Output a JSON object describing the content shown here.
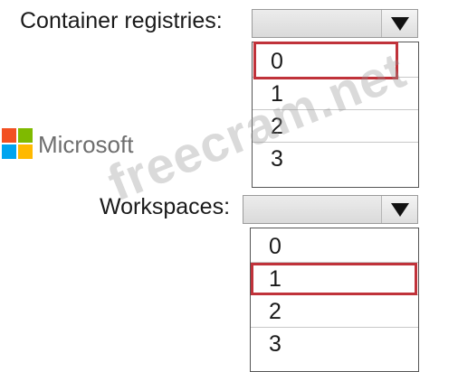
{
  "container_registries": {
    "label": "Container registries:",
    "options": [
      "0",
      "1",
      "2",
      "3"
    ],
    "selected": "0"
  },
  "workspaces": {
    "label": "Workspaces:",
    "options": [
      "0",
      "1",
      "2",
      "3"
    ],
    "selected": "1"
  },
  "logo": {
    "text": "Microsoft",
    "colors": [
      "#f25022",
      "#7fba00",
      "#00a4ef",
      "#ffb900"
    ]
  },
  "watermark": {
    "text": "freecram.net"
  },
  "icons": {
    "dropdown_arrow": "triangle-down-icon"
  },
  "accent": {
    "selection_border": "#c0323a"
  }
}
